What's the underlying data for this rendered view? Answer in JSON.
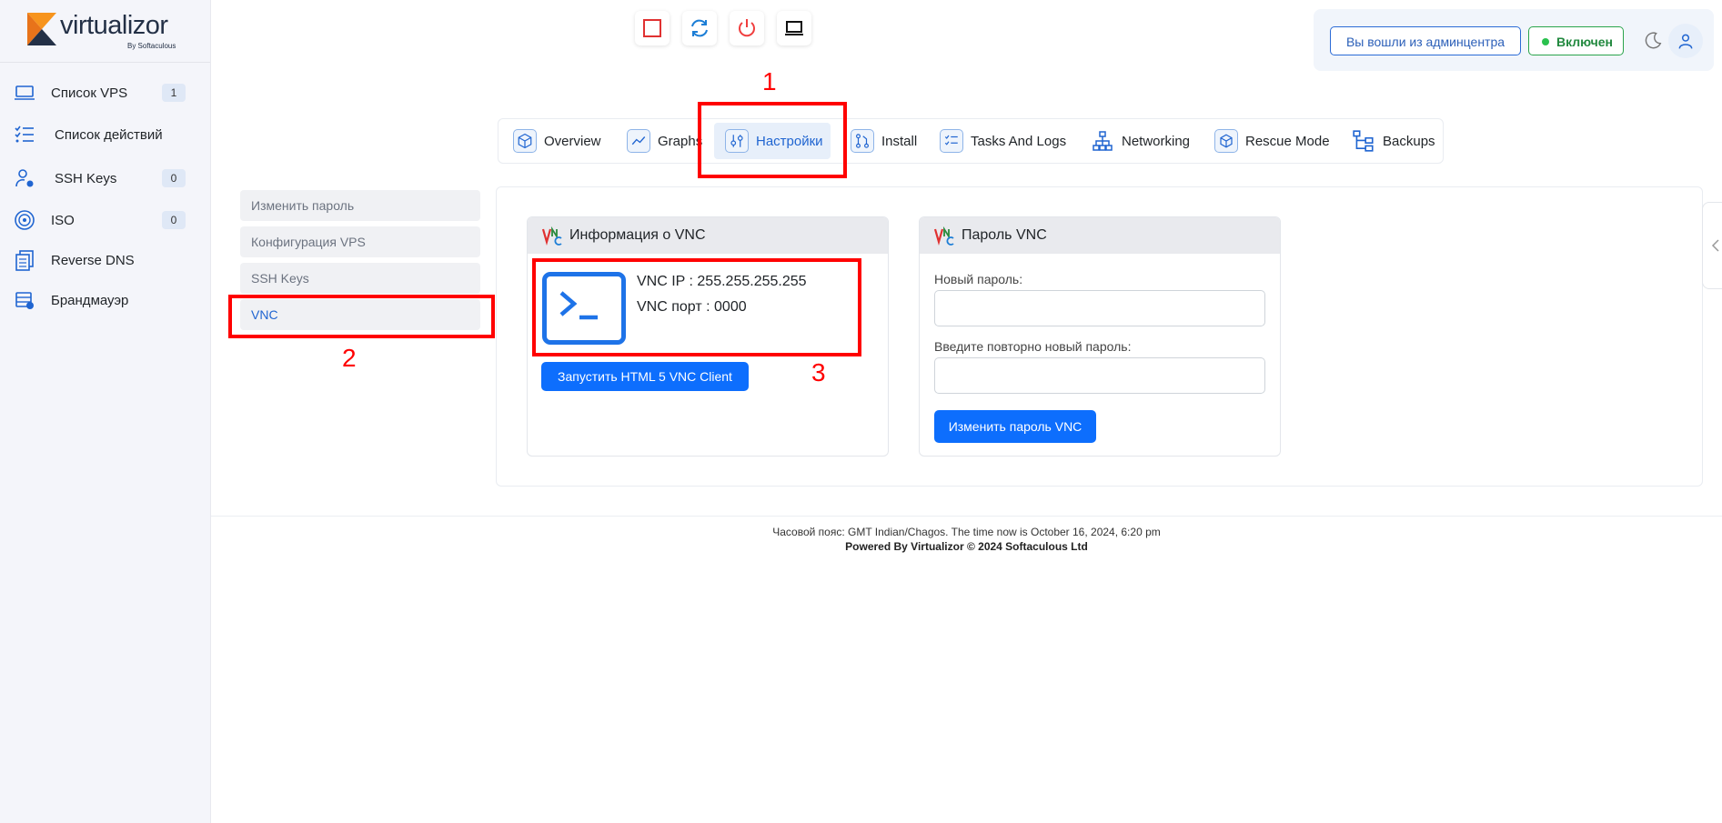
{
  "brand": {
    "name": "virtualizor",
    "sub": "By Softaculous"
  },
  "sidebar": {
    "items": [
      {
        "label": "Список VPS",
        "badge": "1",
        "icon": "laptop-icon"
      },
      {
        "label": "Список действий",
        "icon": "task-list-icon"
      },
      {
        "label": "SSH Keys",
        "badge": "0",
        "icon": "user-key-icon"
      },
      {
        "label": "ISO",
        "badge": "0",
        "icon": "disc-icon"
      },
      {
        "label": "Reverse DNS",
        "icon": "documents-icon"
      },
      {
        "label": "Брандмауэр",
        "icon": "firewall-icon"
      }
    ]
  },
  "toolbar": {
    "stop_icon": "stop-icon",
    "restart_icon": "restart-icon",
    "power_icon": "power-icon",
    "console_icon": "laptop-icon"
  },
  "header": {
    "admin_button": "Вы вошли из админцентра",
    "status_button": "Включен",
    "theme_icon": "moon-icon",
    "user_icon": "user-icon"
  },
  "tabs": [
    {
      "label": "Overview",
      "icon": "cube-icon"
    },
    {
      "label": "Graphs",
      "icon": "chart-line-icon"
    },
    {
      "label": "Настройки",
      "icon": "sliders-icon",
      "active": true
    },
    {
      "label": "Install",
      "icon": "git-icon"
    },
    {
      "label": "Tasks And Logs",
      "icon": "checklist-icon"
    },
    {
      "label": "Networking",
      "icon": "network-icon"
    },
    {
      "label": "Rescue Mode",
      "icon": "rescue-cube-icon"
    },
    {
      "label": "Backups",
      "icon": "backup-tree-icon"
    }
  ],
  "submenu": [
    {
      "label": "Изменить пароль"
    },
    {
      "label": "Конфигурация VPS"
    },
    {
      "label": "SSH Keys"
    },
    {
      "label": "VNC",
      "active": true
    }
  ],
  "vnc_info": {
    "title": "Информация о VNC",
    "ip_label": "VNC IP :",
    "ip_value": "255.255.255.255",
    "port_label": "VNC порт :",
    "port_value": "0000",
    "launch_button": "Запустить HTML 5 VNC Client"
  },
  "vnc_password": {
    "title": "Пароль VNC",
    "new_label": "Новый пароль:",
    "repeat_label": "Введите повторно новый пароль:",
    "submit_button": "Изменить пароль VNC"
  },
  "annotations": {
    "n1": "1",
    "n2": "2",
    "n3": "3"
  },
  "footer": {
    "line1": "Часовой пояс: GMT Indian/Chagos. The time now is October 16, 2024, 6:20 pm",
    "line2": "Powered By Virtualizor © 2024 Softaculous Ltd"
  },
  "colors": {
    "accent": "#0d6efd",
    "annotation": "#ff0000",
    "success": "#2aa44c"
  }
}
